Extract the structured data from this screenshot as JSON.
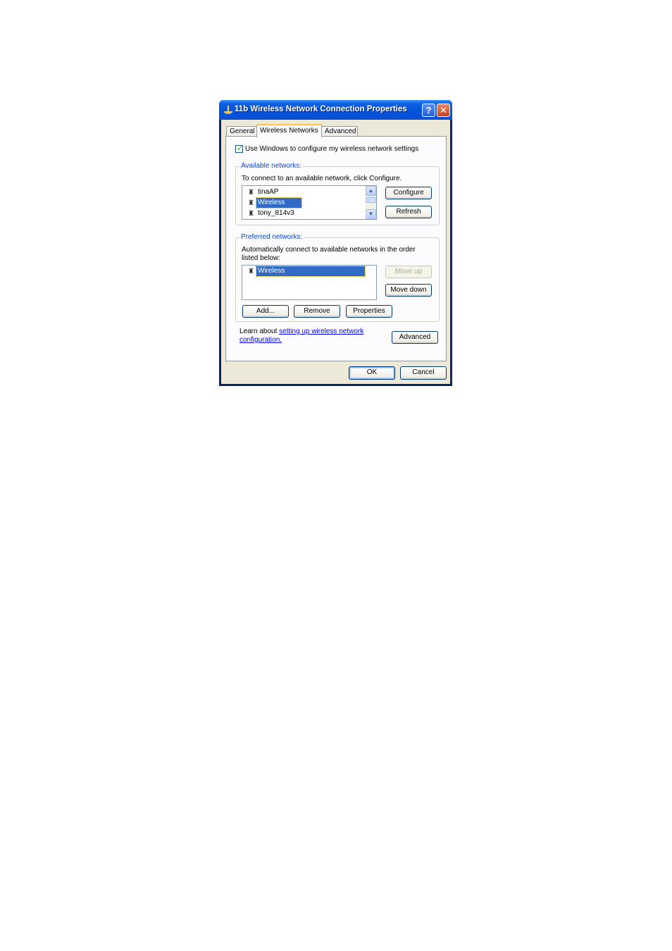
{
  "window": {
    "title": "11b Wireless Network Connection Properties",
    "title_icon": "network-connection-icon",
    "help_glyph": "?",
    "close_glyph": "✕"
  },
  "tabs": [
    {
      "label": "General",
      "active": false
    },
    {
      "label": "Wireless Networks",
      "active": true
    },
    {
      "label": "Advanced",
      "active": false
    }
  ],
  "use_windows_checkbox": {
    "checked": true,
    "label": "Use Windows to configure my wireless network settings"
  },
  "available_networks": {
    "group_title": "Available networks:",
    "instruction": "To connect to an available network, click Configure.",
    "items": [
      {
        "name": "tinaAP",
        "icon": "antenna-icon",
        "selected": false
      },
      {
        "name": "Wireless",
        "icon": "antenna-icon",
        "selected": true
      },
      {
        "name": "tony_814v3",
        "icon": "antenna-icon",
        "selected": false
      }
    ],
    "configure_label": "Configure",
    "refresh_label": "Refresh"
  },
  "preferred_networks": {
    "group_title": "Preferred networks:",
    "instruction": "Automatically connect to available networks in the order listed below:",
    "items": [
      {
        "name": "Wireless",
        "icon": "antenna-icon",
        "selected": true
      }
    ],
    "move_up_label": "Move up",
    "move_down_label": "Move down",
    "add_label": "Add...",
    "remove_label": "Remove",
    "properties_label": "Properties"
  },
  "learn_about": {
    "prefix": "Learn about ",
    "link_line1": "setting up wireless network",
    "link_line2": "configuration."
  },
  "advanced_label": "Advanced",
  "footer": {
    "ok_label": "OK",
    "cancel_label": "Cancel"
  }
}
